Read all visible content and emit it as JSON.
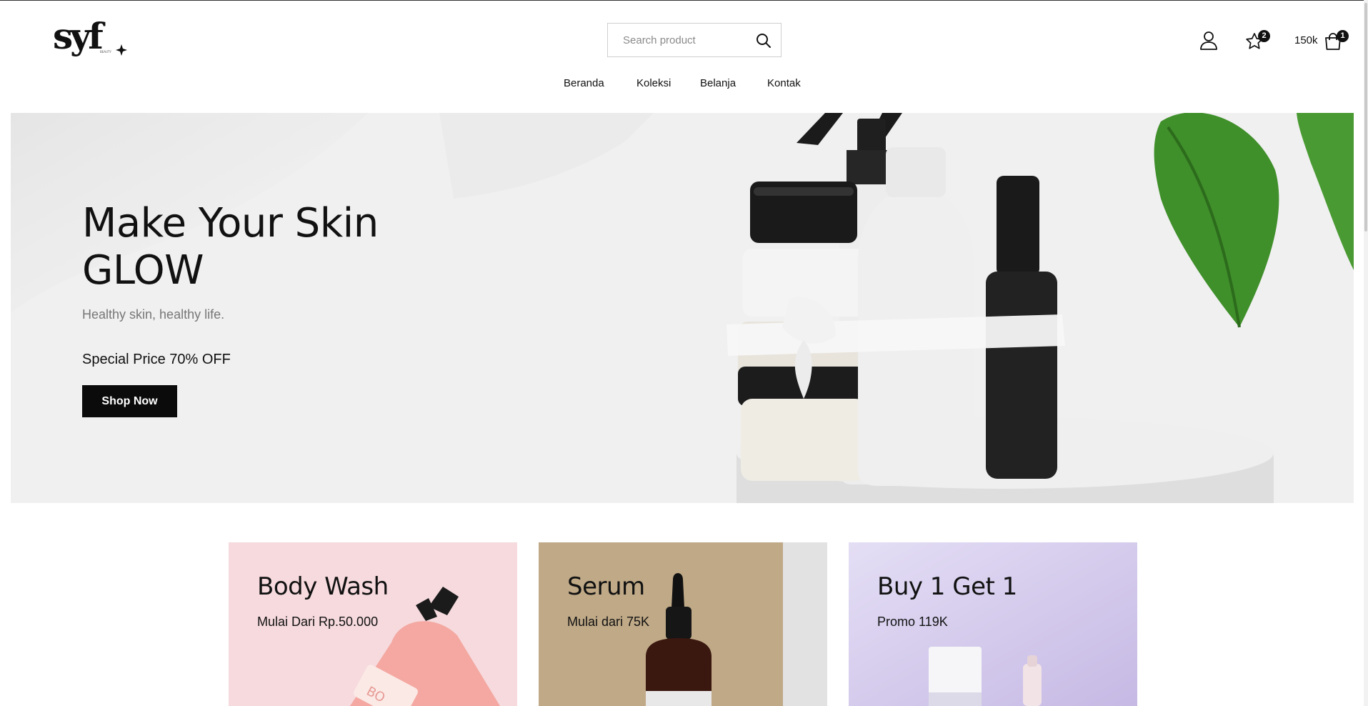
{
  "header": {
    "search": {
      "placeholder": "Search product",
      "value": ""
    },
    "nav": [
      {
        "label": "Beranda"
      },
      {
        "label": "Koleksi"
      },
      {
        "label": "Belanja"
      },
      {
        "label": "Kontak"
      }
    ],
    "wishlist_count": "2",
    "cart_total": "150k",
    "cart_count": "1",
    "icons": [
      "user-icon",
      "star-icon",
      "shopping-bag-icon",
      "search-icon"
    ]
  },
  "hero": {
    "title_line1": "Make Your Skin",
    "title_line2": "GLOW",
    "subtitle": "Healthy skin, healthy life.",
    "price_text": "Special Price 70% OFF",
    "cta_label": "Shop Now"
  },
  "cards": [
    {
      "title": "Body Wash",
      "subtitle": "Mulai Dari Rp.50.000",
      "bg": "#f6dade"
    },
    {
      "title": "Serum",
      "subtitle": "Mulai dari 75K",
      "bg": "#bfa987"
    },
    {
      "title": "Buy 1 Get 1",
      "subtitle": "Promo 119K",
      "bg": "#d8d0ee"
    }
  ],
  "colors": {
    "accent": "#0b0b0b",
    "hero_bg": "#f0f0f0",
    "leaf": "#3f8f2a"
  }
}
